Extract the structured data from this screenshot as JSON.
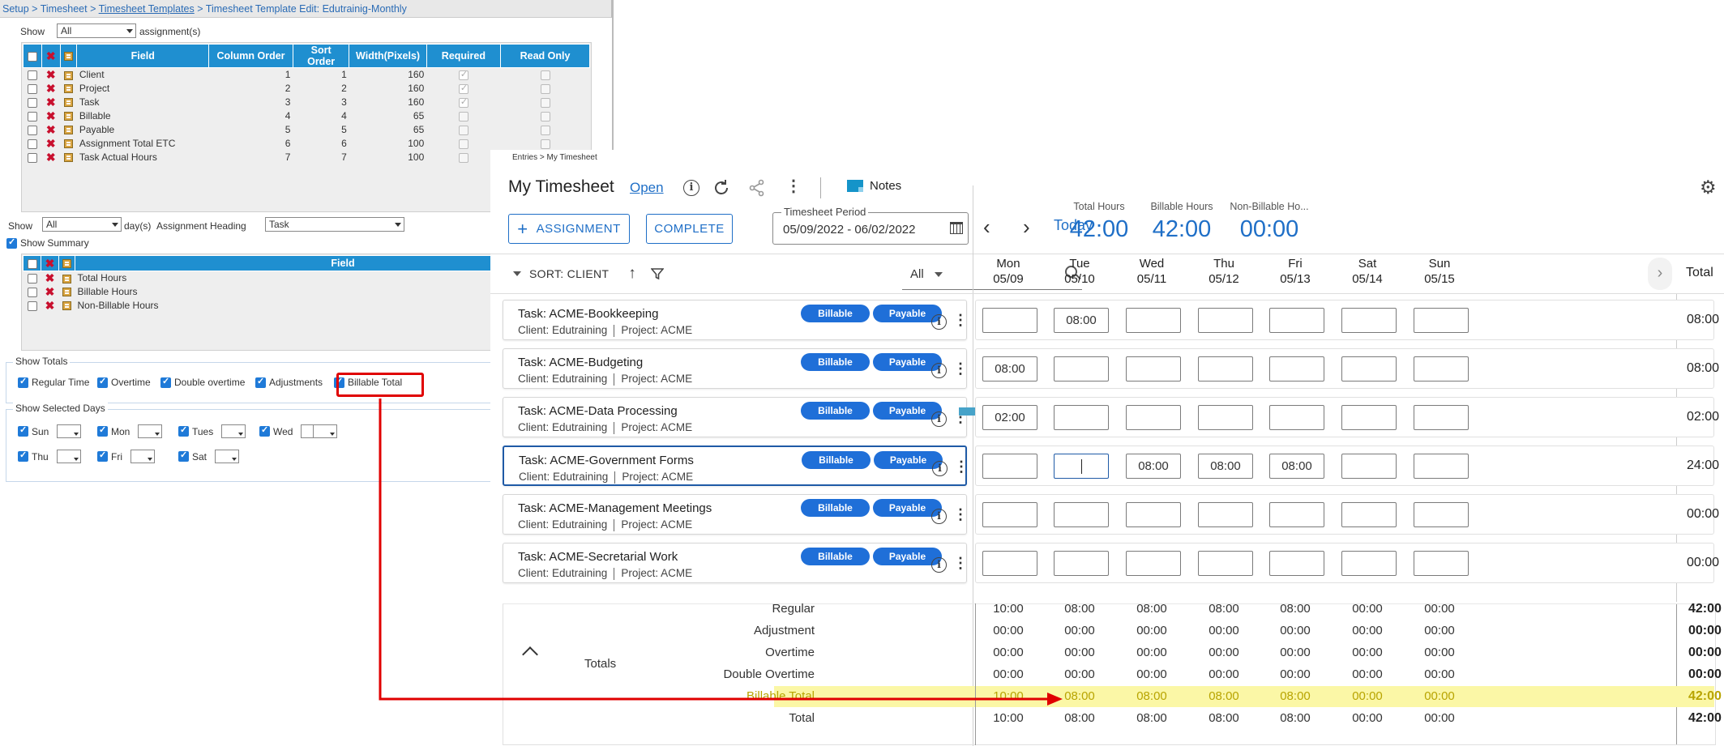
{
  "breadcrumb": {
    "setup": "Setup",
    "sep": " > ",
    "timesheet": "Timesheet",
    "templates": "Timesheet Templates",
    "current": "Timesheet Template Edit: Edutrainig-Monthly"
  },
  "assignments_filter": {
    "show_label": "Show",
    "value": "All",
    "suffix": "assignment(s)"
  },
  "field_grid": {
    "headers": [
      "Field",
      "Column Order",
      "Sort Order",
      "Width(Pixels)",
      "Required",
      "Read Only"
    ],
    "rows": [
      {
        "field": "Client",
        "col": "1",
        "sort": "1",
        "width": "160",
        "required": true
      },
      {
        "field": "Project",
        "col": "2",
        "sort": "2",
        "width": "160",
        "required": true
      },
      {
        "field": "Task",
        "col": "3",
        "sort": "3",
        "width": "160",
        "required": true
      },
      {
        "field": "Billable",
        "col": "4",
        "sort": "4",
        "width": "65",
        "required": false
      },
      {
        "field": "Payable",
        "col": "5",
        "sort": "5",
        "width": "65",
        "required": false
      },
      {
        "field": "Assignment Total ETC",
        "col": "6",
        "sort": "6",
        "width": "100",
        "required": false
      },
      {
        "field": "Task Actual Hours",
        "col": "7",
        "sort": "7",
        "width": "100",
        "required": false
      }
    ]
  },
  "days_filter": {
    "show_label": "Show",
    "value": "All",
    "suffix": "day(s)",
    "heading_label": "Assignment Heading",
    "heading_value": "Task"
  },
  "show_summary": "Show Summary",
  "summary_grid": {
    "header": "Field",
    "rows": [
      "Total Hours",
      "Billable Hours",
      "Non-Billable Hours"
    ]
  },
  "show_totals": {
    "legend": "Show Totals",
    "options": [
      "Regular Time",
      "Overtime",
      "Double overtime",
      "Adjustments",
      "Billable Total"
    ]
  },
  "show_days": {
    "legend": "Show Selected Days",
    "row1": [
      "Sun",
      "Mon",
      "Tues",
      "Wed"
    ],
    "row2": [
      "Thu",
      "Fri",
      "Sat"
    ]
  },
  "timesheet": {
    "crumb": "Entries > My Timesheet",
    "title": "My Timesheet",
    "status": "Open",
    "notes_label": "Notes",
    "assignment_btn": "ASSIGNMENT",
    "complete_btn": "COMPLETE",
    "period_label": "Timesheet Period",
    "period_value": "05/09/2022 - 06/02/2022",
    "today": "Today",
    "stats": [
      {
        "label": "Total Hours",
        "value": "42:00"
      },
      {
        "label": "Billable Hours",
        "value": "42:00"
      },
      {
        "label": "Non-Billable Ho...",
        "value": "00:00"
      }
    ],
    "sort_label": "SORT: CLIENT",
    "search_filter": "All",
    "days": [
      {
        "day": "Mon",
        "date": "05/09"
      },
      {
        "day": "Tue",
        "date": "05/10"
      },
      {
        "day": "Wed",
        "date": "05/11"
      },
      {
        "day": "Thu",
        "date": "05/12"
      },
      {
        "day": "Fri",
        "date": "05/13"
      },
      {
        "day": "Sat",
        "date": "05/14"
      },
      {
        "day": "Sun",
        "date": "05/15"
      }
    ],
    "total_header": "Total",
    "badges": {
      "billable": "Billable",
      "payable": "Payable"
    },
    "tasks": [
      {
        "name": "Task: ACME-Bookkeeping",
        "client": "Client: Edutraining",
        "project": "Project: ACME",
        "hours": [
          "",
          "08:00",
          "",
          "",
          "",
          "",
          ""
        ],
        "total": "08:00"
      },
      {
        "name": "Task: ACME-Budgeting",
        "client": "Client: Edutraining",
        "project": "Project: ACME",
        "hours": [
          "08:00",
          "",
          "",
          "",
          "",
          "",
          ""
        ],
        "total": "08:00"
      },
      {
        "name": "Task: ACME-Data Processing",
        "client": "Client: Edutraining",
        "project": "Project: ACME",
        "hours": [
          "02:00",
          "",
          "",
          "",
          "",
          "",
          ""
        ],
        "total": "02:00"
      },
      {
        "name": "Task: ACME-Government Forms",
        "client": "Client: Edutraining",
        "project": "Project: ACME",
        "hours": [
          "",
          "",
          "08:00",
          "08:00",
          "08:00",
          "",
          ""
        ],
        "total": "24:00"
      },
      {
        "name": "Task: ACME-Management Meetings",
        "client": "Client: Edutraining",
        "project": "Project: ACME",
        "hours": [
          "",
          "",
          "",
          "",
          "",
          "",
          ""
        ],
        "total": "00:00"
      },
      {
        "name": "Task: ACME-Secretarial Work",
        "client": "Client: Edutraining",
        "project": "Project: ACME",
        "hours": [
          "",
          "",
          "",
          "",
          "",
          "",
          ""
        ],
        "total": "00:00"
      }
    ],
    "totals_label": "Totals",
    "totals": [
      {
        "label": "Regular",
        "values": [
          "10:00",
          "08:00",
          "08:00",
          "08:00",
          "08:00",
          "00:00",
          "00:00"
        ],
        "total": "42:00"
      },
      {
        "label": "Adjustment",
        "values": [
          "00:00",
          "00:00",
          "00:00",
          "00:00",
          "00:00",
          "00:00",
          "00:00"
        ],
        "total": "00:00"
      },
      {
        "label": "Overtime",
        "values": [
          "00:00",
          "00:00",
          "00:00",
          "00:00",
          "00:00",
          "00:00",
          "00:00"
        ],
        "total": "00:00"
      },
      {
        "label": "Double Overtime",
        "values": [
          "00:00",
          "00:00",
          "00:00",
          "00:00",
          "00:00",
          "00:00",
          "00:00"
        ],
        "total": "00:00"
      },
      {
        "label": "Billable Total",
        "values": [
          "10:00",
          "08:00",
          "08:00",
          "08:00",
          "08:00",
          "00:00",
          "00:00"
        ],
        "total": "42:00"
      },
      {
        "label": "Total",
        "values": [
          "10:00",
          "08:00",
          "08:00",
          "08:00",
          "08:00",
          "00:00",
          "00:00"
        ],
        "total": "42:00"
      }
    ]
  },
  "colors": {
    "accent": "#1f6fc7",
    "grid_header": "#1f8fd0",
    "highlight": "#fbf7a6",
    "annotation": "#e00000"
  }
}
